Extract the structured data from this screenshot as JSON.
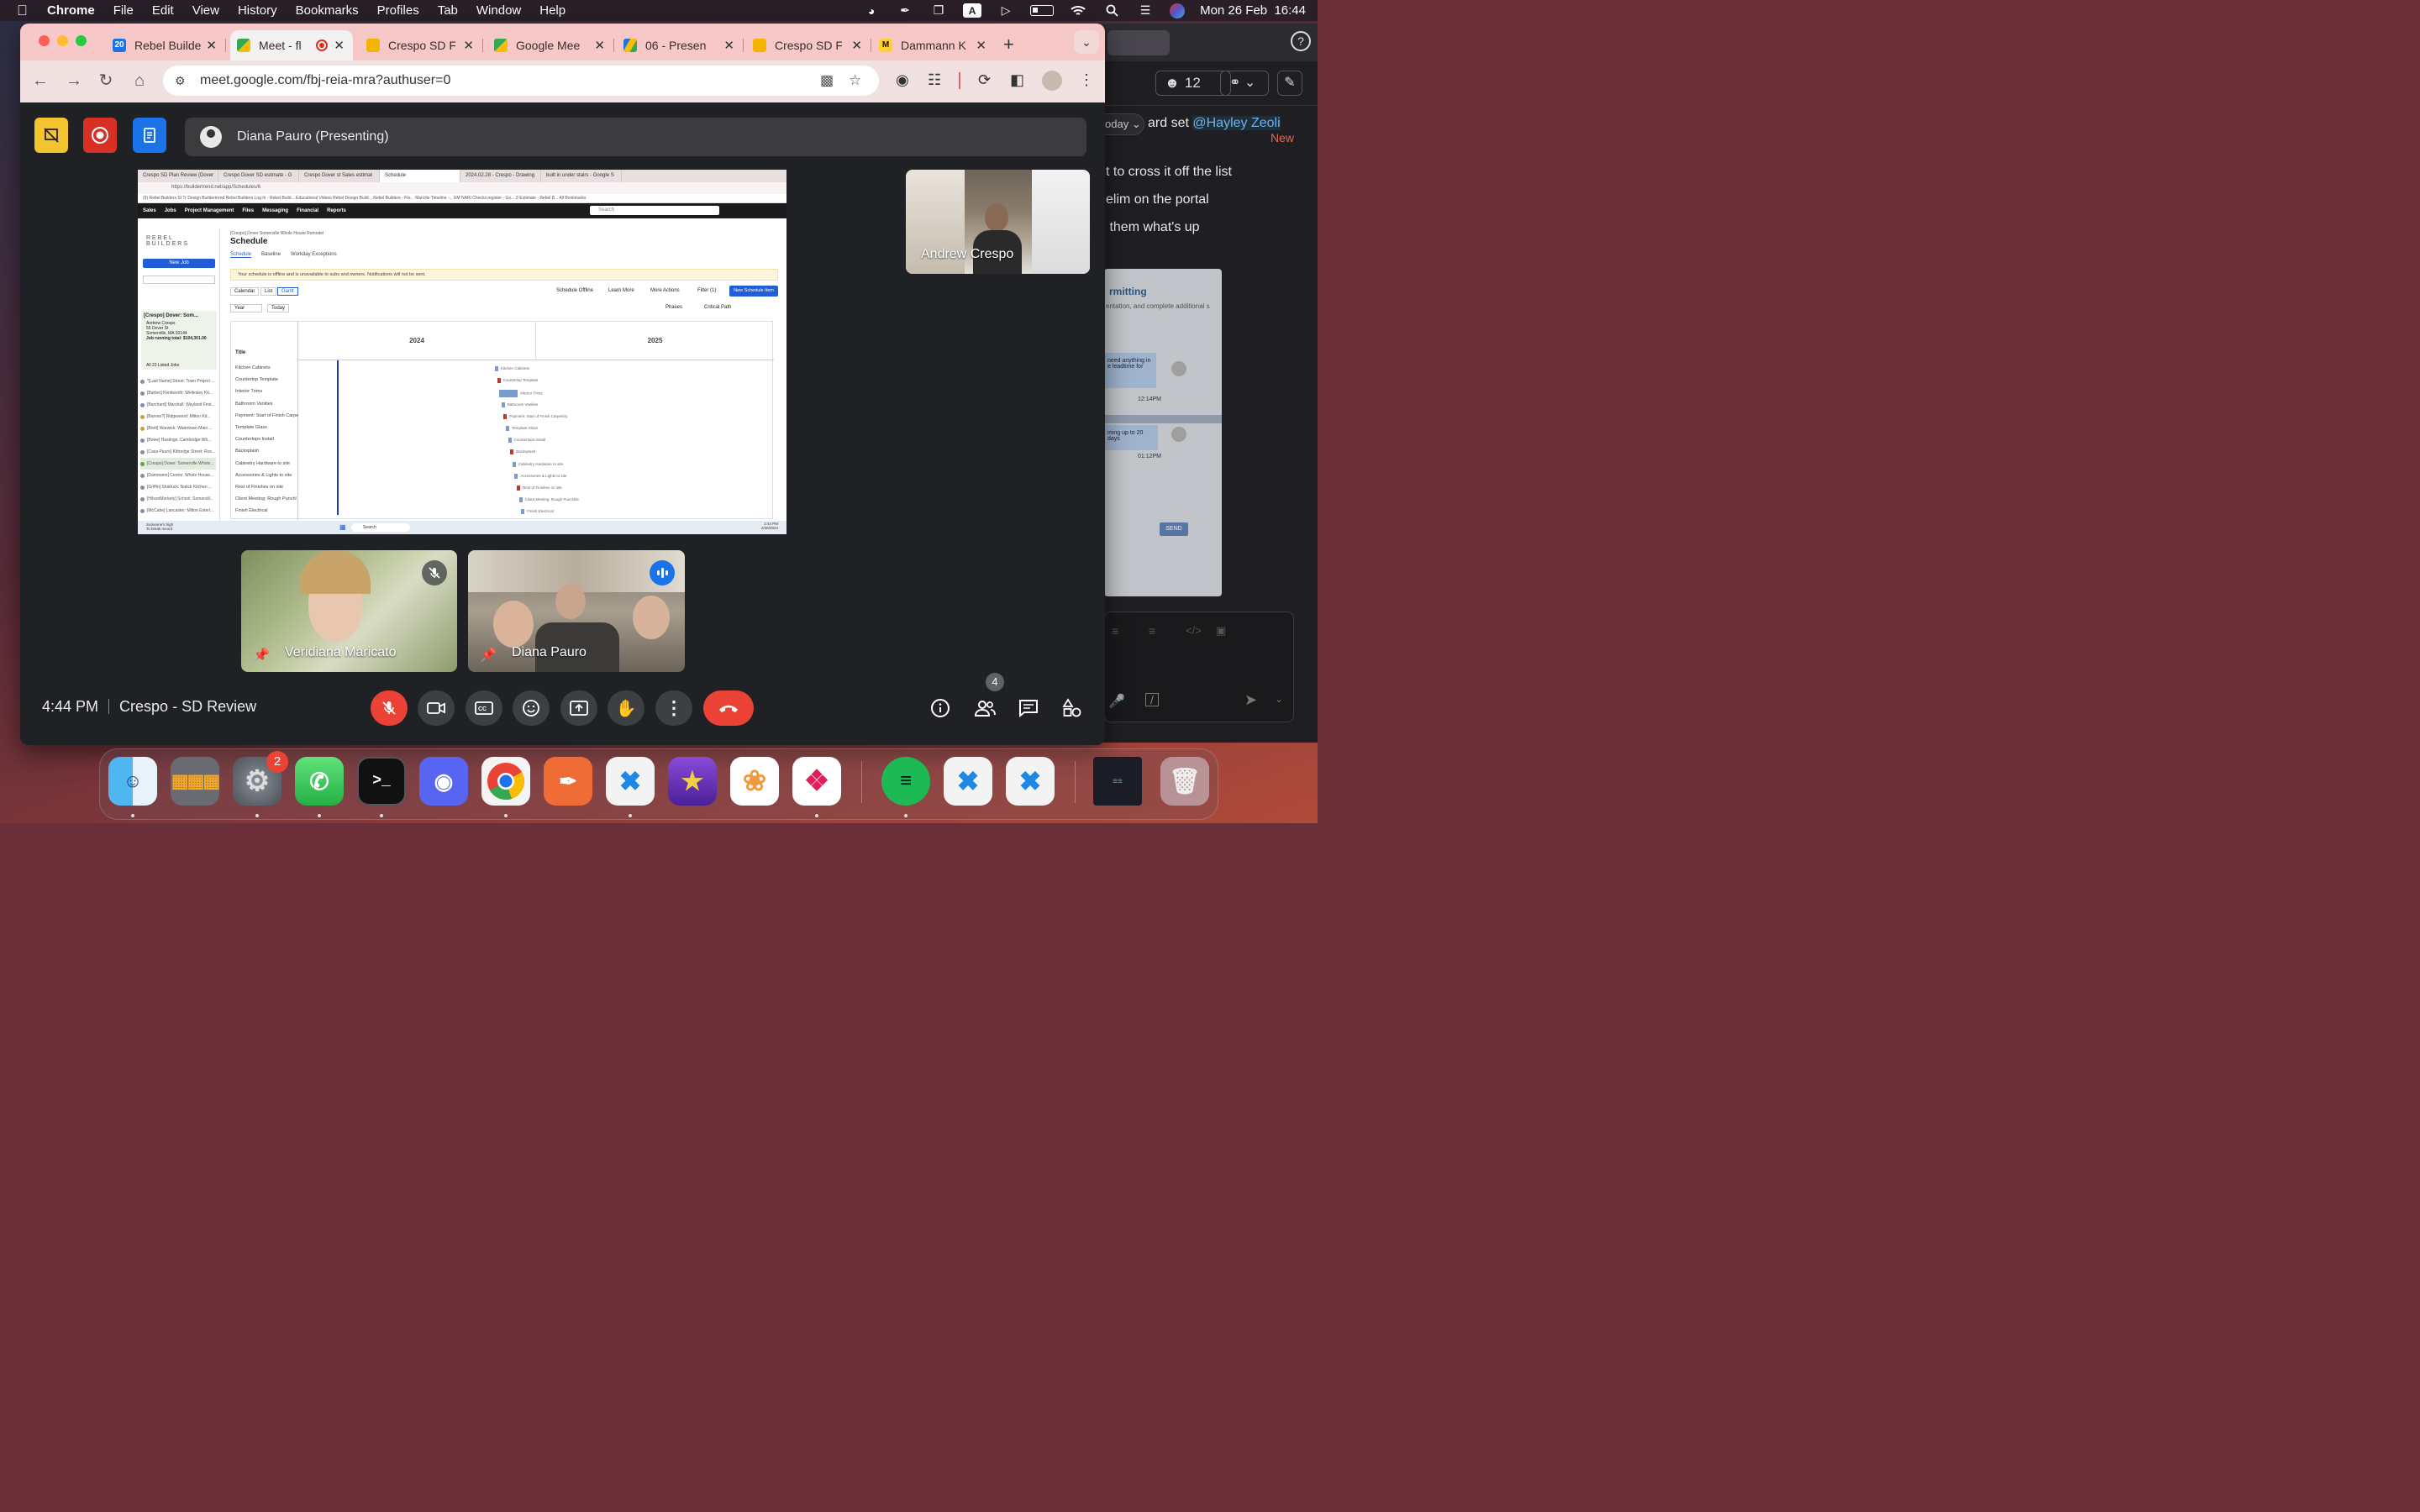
{
  "menubar": {
    "app_name": "Chrome",
    "menus": [
      "File",
      "Edit",
      "View",
      "History",
      "Bookmarks",
      "Profiles",
      "Tab",
      "Window",
      "Help"
    ],
    "input_source": "A",
    "datetime": "Mon 26 Feb  16:44"
  },
  "browser": {
    "tabs": [
      {
        "title": "Rebel Builde",
        "favicon": "calendar-icon",
        "fav_text": "20"
      },
      {
        "title": "Meet - fl",
        "favicon": "meet-icon",
        "active": true
      },
      {
        "title": "Crespo SD F",
        "favicon": "slides-icon"
      },
      {
        "title": "Google Mee",
        "favicon": "meet-icon"
      },
      {
        "title": "06 - Presen",
        "favicon": "drive-icon"
      },
      {
        "title": "Crespo SD F",
        "favicon": "slides-icon"
      },
      {
        "title": "Dammann K",
        "favicon": "miro-icon"
      }
    ],
    "url": "meet.google.com/fbj-reia-mra?authuser=0"
  },
  "meet": {
    "presenter_banner": "Diana Pauro (Presenting)",
    "meeting_time": "4:44 PM",
    "meeting_title": "Crespo - SD Review",
    "participants_count": "4",
    "participants": [
      {
        "name": "Andrew Crespo"
      },
      {
        "name": "Veridiana Maricato",
        "muted": true
      },
      {
        "name": "Diana Pauro",
        "speaking": true
      }
    ],
    "colors": {
      "accent_red": "#ea4335",
      "accent_blue": "#1a73e8",
      "meet_bg": "#202124"
    }
  },
  "shared_screen": {
    "tabs": [
      "Crespo SD Plan Review (Dover",
      "Crespo Dover SD estimate - G",
      "Crespo Dover st Sales estimat",
      "Schedule",
      "2024.02.28 - Crespo - Drawing",
      "built in under stairs - Google S"
    ],
    "url": "https://buildertrend.net/app/Schedules/6",
    "bookmarks": "(9) Rebel Builders   SI Tr Design   Buildertrend   Rebel Builders   Log In - Rebel Build...   Educational Videos   Rebel Design Build...   Rebel Builders - Fre...   Marcilio Timeline -...   EM NARI   Checks register - Go...   Z-Estimate - Rebel B...   All Bookmarks",
    "nav": [
      "Sales",
      "Jobs",
      "Project Management",
      "Files",
      "Messaging",
      "Financial",
      "Reports"
    ],
    "search_placeholder": "Search",
    "logo": "REBEL BUILDERS",
    "new_job": "New Job",
    "job_title": "[Crespo] Dover: Som...",
    "job_details": [
      "Andrew Crespo",
      "55 Dover St",
      "Somerville, MA 02144",
      "Job running total: $104,301.00"
    ],
    "all_jobs": "All 23 Listed Jobs",
    "jobs": [
      "*[Last Name] Street: Town Project ...",
      "[Barber] Kenilworth: Wellesley Kit...",
      "[Barchard] Marshall: Wayland First...",
      "[Barnes?] Ridgewood: Milton Kit...",
      "[Brett] Warwick: Watertown Main ...",
      "[Bowe] Hastings: Cambridge Wh...",
      "[Casa Pauro] Kittredge Street: Ros...",
      "[Crespo] Dover: Somerville Whole...",
      "[Dammann] Centre: Whole House...",
      "[Griffin] Shattuck: Natick Kitchen ...",
      "[HilsonMoriarty] School: Somervill...",
      "[McCabe] Lancaster: Milton Exteri..."
    ],
    "breadcrumb": "[Crespo] Dover Somerville Whole House Remodel",
    "page_title": "Schedule",
    "subtabs": [
      "Schedule",
      "Baseline",
      "Workday Exceptions"
    ],
    "warning": "Your schedule is offline and is unavailable to subs and owners. Notifications will not be sent.",
    "view_tabs": [
      "Calendar",
      "List",
      "Gantt"
    ],
    "actions": [
      "Schedule Offline",
      "Learn More",
      "More Actions",
      "Filter (1)"
    ],
    "new_schedule_item": "New Schedule Item",
    "zoom_select": "Year",
    "today_btn": "Today",
    "toggles": [
      "Phases",
      "Critical Path"
    ],
    "title_header": "Title",
    "years": [
      "2024",
      "2025"
    ],
    "tasks": [
      "Kitchen Cabinets",
      "Countertop Template",
      "Interior Trims",
      "Bathroom Vanities",
      "Payment: Start of Finish Carpe",
      "Template Glass",
      "Countertops Install",
      "Backsplash",
      "Cabinetry Hardware to site",
      "Accessories & Lights to site",
      "Rest of Finishes on site",
      "Client Meeting: Rough Punchl",
      "Finish Electrical"
    ],
    "bar_labels": [
      "Kitchen Cabinets",
      "Countertop Template",
      "Interior Trims",
      "Bathroom Vanities",
      "Payment: Start of Finish Carpentry",
      "Template Glass",
      "Countertops Install",
      "Backsplash",
      "Cabinetry Hardware to site",
      "Accessories & Lights to site",
      "Rest of Finishes on site",
      "Client Meeting: Rough Punchlist",
      "Finish Electrical"
    ],
    "taskbar_left": "Someone's high\nTo break record",
    "taskbar_search": "Search",
    "taskbar_time": "2:44 PM",
    "taskbar_date": "2/26/2024"
  },
  "slack": {
    "member_count": "12",
    "today_label": "oday",
    "lines": [
      "ard set",
      "@Hayley Zeoli",
      "t to cross it off the list",
      "elim on the portal",
      " them what's up"
    ],
    "new_label": "New",
    "card_title": "rmitting",
    "card_sub": "entation, and complete additional s",
    "chat1": "need anything in e leadtime for",
    "chat1_time": "12:14PM",
    "chat2": "ming up to 20 days",
    "chat2_time": "01:12PM",
    "send": "SEND"
  },
  "dock": {
    "apps": [
      "Finder",
      "Launchpad",
      "System Settings",
      "WhatsApp",
      "Terminal",
      "Discord",
      "Chrome",
      "Postman",
      "VS Code",
      "iMovie",
      "Photos",
      "Slack",
      "Spotify",
      "VS Code",
      "VS Code",
      "Trash"
    ],
    "settings_badge": "2",
    "terminal_glyph": ">_"
  }
}
